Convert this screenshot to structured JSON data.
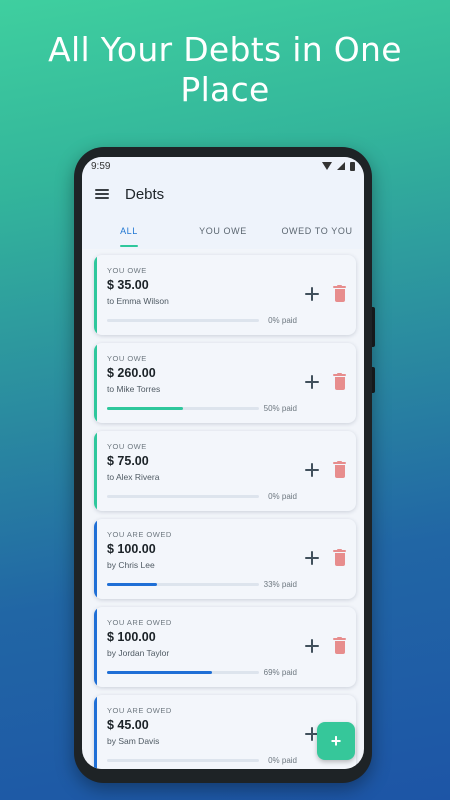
{
  "headline": {
    "line1": "All Your Debts in One",
    "line2": "Place"
  },
  "status_bar": {
    "time": "9:59",
    "icons": [
      "wifi-icon",
      "signal-icon",
      "battery-icon"
    ]
  },
  "app_bar": {
    "menu_icon": "menu-icon",
    "title": "Debts"
  },
  "tabs": [
    {
      "label": "ALL",
      "active": true
    },
    {
      "label": "YOU OWE",
      "active": false
    },
    {
      "label": "OWED TO YOU",
      "active": false
    }
  ],
  "colors": {
    "you_owe": "#2ec79c",
    "owed_to_you": "#1f6fd6",
    "accent": "#1f76d2",
    "fab": "#36c79a",
    "delete": "#e78d8d"
  },
  "debts": [
    {
      "kind": "YOU OWE",
      "amount": "$ 35.00",
      "person": "to Emma Wilson",
      "progress": 0,
      "paid_label": "0% paid",
      "color": "#2ec79c"
    },
    {
      "kind": "YOU OWE",
      "amount": "$ 260.00",
      "person": "to Mike Torres",
      "progress": 0.5,
      "paid_label": "50% paid",
      "color": "#2ec79c"
    },
    {
      "kind": "YOU OWE",
      "amount": "$ 75.00",
      "person": "to Alex Rivera",
      "progress": 0,
      "paid_label": "0% paid",
      "color": "#2ec79c"
    },
    {
      "kind": "YOU ARE OWED",
      "amount": "$ 100.00",
      "person": "by Chris Lee",
      "progress": 0.33,
      "paid_label": "33% paid",
      "color": "#1f6fd6"
    },
    {
      "kind": "YOU ARE OWED",
      "amount": "$ 100.00",
      "person": "by Jordan Taylor",
      "progress": 0.69,
      "paid_label": "69% paid",
      "color": "#1f6fd6"
    },
    {
      "kind": "YOU ARE OWED",
      "amount": "$ 45.00",
      "person": "by Sam Davis",
      "progress": 0,
      "paid_label": "0% paid",
      "color": "#1f6fd6"
    }
  ],
  "fab": {
    "label": "+",
    "icon": "plus-icon"
  }
}
